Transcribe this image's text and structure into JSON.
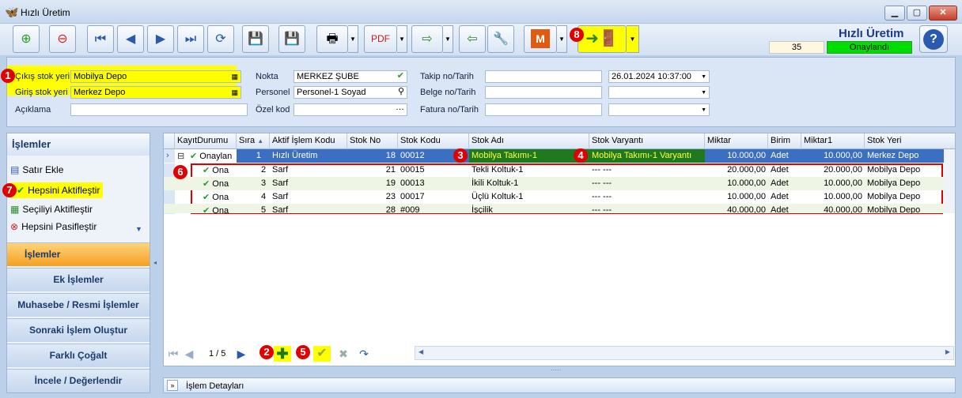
{
  "window": {
    "title": "Hızlı Üretim"
  },
  "header": {
    "title": "Hızlı Üretim",
    "record_no": "35",
    "status": "Onaylandı",
    "status_color": "#00dd00"
  },
  "markers": [
    "1",
    "2",
    "3",
    "4",
    "5",
    "6",
    "7",
    "8"
  ],
  "form": {
    "cikis_label": "Çıkış stok yeri",
    "cikis_value": "Mobilya Depo",
    "giris_label": "Giriş stok yeri",
    "giris_value": "Merkez Depo",
    "aciklama_label": "Açıklama",
    "aciklama_value": "",
    "nokta_label": "Nokta",
    "nokta_value": "MERKEZ ŞUBE",
    "personel_label": "Personel",
    "personel_value": "Personel-1 Soyad",
    "ozelkod_label": "Özel kod",
    "ozelkod_value": "",
    "takip_label": "Takip no/Tarih",
    "takip_value": "",
    "takip_date": "26.01.2024 10:37:00",
    "belge_label": "Belge no/Tarih",
    "belge_value": "",
    "belge_date": "",
    "fatura_label": "Fatura no/Tarih",
    "fatura_value": "",
    "fatura_date": ""
  },
  "left": {
    "title": "İşlemler",
    "actions": [
      "Satır Ekle",
      "Hepsini Aktifleştir",
      "Seçiliyi Aktifleştir",
      "Hepsini Pasifleştir"
    ],
    "nav": [
      "İşlemler",
      "Ek İşlemler",
      "Muhasebe / Resmi İşlemler",
      "Sonraki İşlem Oluştur",
      "Farklı Çoğalt",
      "İncele / Değerlendir"
    ]
  },
  "grid": {
    "columns": [
      "KayıtDurumu",
      "Sıra",
      "Aktif İşlem Kodu",
      "Stok No",
      "Stok Kodu",
      "Stok Adı",
      "Stok Varyantı",
      "Miktar",
      "Birim",
      "Miktar1",
      "Stok Yeri"
    ],
    "main_row": {
      "durum": "Onaylan",
      "sira": "1",
      "kod": "Hızlı Üretim",
      "stokno": "18",
      "stokkodu": "00012",
      "stokadi": "Mobilya Takımı-1",
      "varyant": "Mobilya Takımı-1 Varyantı",
      "miktar": "10.000,00",
      "birim": "Adet",
      "miktar1": "10.000,00",
      "yer": "Merkez Depo"
    },
    "sub_rows": [
      {
        "durum": "Ona",
        "sira": "2",
        "kod": "Sarf",
        "stokno": "21",
        "stokkodu": "00015",
        "stokadi": "Tekli Koltuk-1",
        "varyant": "--- ---",
        "miktar": "20.000,00",
        "birim": "Adet",
        "miktar1": "20.000,00",
        "yer": "Mobilya Depo"
      },
      {
        "durum": "Ona",
        "sira": "3",
        "kod": "Sarf",
        "stokno": "19",
        "stokkodu": "00013",
        "stokadi": "İkili Koltuk-1",
        "varyant": "--- ---",
        "miktar": "10.000,00",
        "birim": "Adet",
        "miktar1": "10.000,00",
        "yer": "Mobilya Depo"
      },
      {
        "durum": "Ona",
        "sira": "4",
        "kod": "Sarf",
        "stokno": "23",
        "stokkodu": "00017",
        "stokadi": "Üçlü Koltuk-1",
        "varyant": "--- ---",
        "miktar": "10.000,00",
        "birim": "Adet",
        "miktar1": "10.000,00",
        "yer": "Mobilya Depo"
      },
      {
        "durum": "Ona",
        "sira": "5",
        "kod": "Sarf",
        "stokno": "28",
        "stokkodu": "#009",
        "stokadi": "İşçilik",
        "varyant": "--- ---",
        "miktar": "40.000,00",
        "birim": "Adet",
        "miktar1": "40.000,00",
        "yer": "Mobilya Depo"
      }
    ],
    "pager": "1 / 5"
  },
  "detail": {
    "label": "İşlem Detayları"
  }
}
